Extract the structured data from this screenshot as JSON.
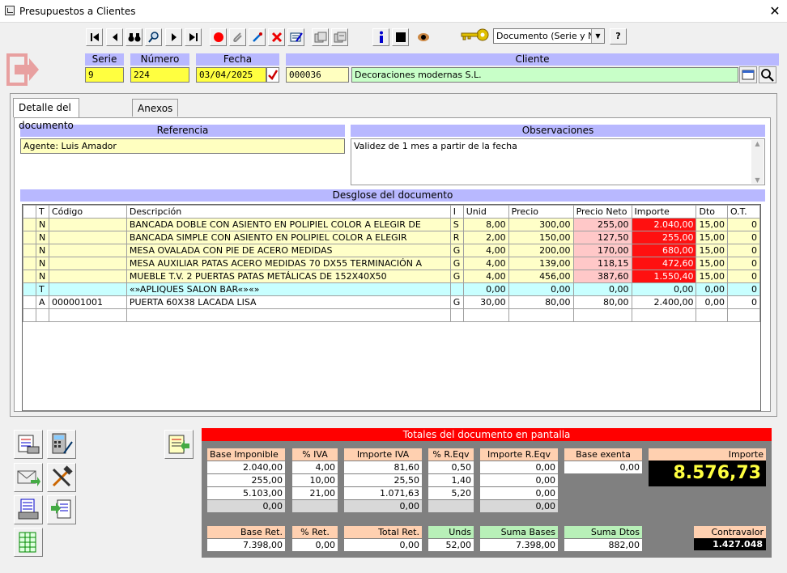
{
  "window": {
    "title": "Presupuestos a Clientes",
    "close": "✕"
  },
  "toolbar": {
    "doc_select": "Documento (Serie y Num",
    "help": "?"
  },
  "header": {
    "serie_label": "Serie",
    "serie": "9",
    "numero_label": "Número",
    "numero": "224",
    "fecha_label": "Fecha",
    "fecha": "03/04/2025",
    "cliente_label": "Cliente",
    "cliente_code": "000036",
    "cliente_name": "Decoraciones modernas S.L."
  },
  "tabs": {
    "detail": "Detalle del documento",
    "annex": "Anexos"
  },
  "referencia": {
    "label": "Referencia",
    "value": "Agente: Luis Amador"
  },
  "observaciones": {
    "label": "Observaciones",
    "value": "Validez de 1 mes a partir de la fecha"
  },
  "desglose": {
    "label": "Desglose del documento",
    "columns": [
      "",
      "T",
      "Código",
      "Descripción",
      "I",
      "Unid",
      "Precio",
      "Precio Neto",
      "Importe",
      "Dto",
      "O.T."
    ],
    "rows": [
      {
        "t": "N",
        "codigo": "",
        "desc": "BANCADA  DOBLE CON ASIENTO EN POLIPIEL COLOR A ELEGIR DE",
        "i": "S",
        "unid": "8,00",
        "precio": "300,00",
        "neto": "255,00",
        "importe": "2.040,00",
        "dto": "15,00",
        "ot": "0"
      },
      {
        "t": "N",
        "codigo": "",
        "desc": "BANCADA  SIMPLE  CON ASIENTO EN POLIPIEL COLOR A ELEGIR",
        "i": "R",
        "unid": "2,00",
        "precio": "150,00",
        "neto": "127,50",
        "importe": "255,00",
        "dto": "15,00",
        "ot": "0"
      },
      {
        "t": "N",
        "codigo": "",
        "desc": "MESA OVALADA CON PIE DE ACERO MEDIDAS",
        "i": "G",
        "unid": "4,00",
        "precio": "200,00",
        "neto": "170,00",
        "importe": "680,00",
        "dto": "15,00",
        "ot": "0"
      },
      {
        "t": "N",
        "codigo": "",
        "desc": "MESA AUXILIAR PATAS ACERO MEDIDAS 70 DX55  TERMINACIÓN A",
        "i": "G",
        "unid": "4,00",
        "precio": "139,00",
        "neto": "118,15",
        "importe": "472,60",
        "dto": "15,00",
        "ot": "0"
      },
      {
        "t": "N",
        "codigo": "",
        "desc": "MUEBLE T.V. 2 PUERTAS PATAS METÁLICAS DE 152X40X50",
        "i": "G",
        "unid": "4,00",
        "precio": "456,00",
        "neto": "387,60",
        "importe": "1.550,40",
        "dto": "15,00",
        "ot": "0"
      },
      {
        "t": "T",
        "codigo": "",
        "desc": "«»APLIQUES SALON BAR«»«»",
        "i": "",
        "unid": "0,00",
        "precio": "0,00",
        "neto": "0,00",
        "importe": "0,00",
        "dto": "0,00",
        "ot": "0"
      },
      {
        "t": "A",
        "codigo": "000001001",
        "desc": "PUERTA 60X38 LACADA LISA",
        "i": "G",
        "unid": "30,00",
        "precio": "80,00",
        "neto": "80,00",
        "importe": "2.400,00",
        "dto": "0,00",
        "ot": "0"
      }
    ]
  },
  "totals": {
    "title": "Totales del documento en pantalla",
    "h_base": "Base Imponible",
    "h_iva": "% IVA",
    "h_imp_iva": "Importe IVA",
    "h_req": "% R.Eqv",
    "h_imp_req": "Importe R.Eqv",
    "h_exenta": "Base exenta",
    "h_importe": "Importe",
    "rows": [
      {
        "base": "2.040,00",
        "iva": "4,00",
        "imp_iva": "81,60",
        "req": "0,50",
        "imp_req": "0,00"
      },
      {
        "base": "255,00",
        "iva": "10,00",
        "imp_iva": "25,50",
        "req": "1,40",
        "imp_req": "0,00"
      },
      {
        "base": "5.103,00",
        "iva": "21,00",
        "imp_iva": "1.071,63",
        "req": "5,20",
        "imp_req": "0,00"
      },
      {
        "base": "0,00",
        "iva": "",
        "imp_iva": "0,00",
        "req": "",
        "imp_req": "0,00"
      }
    ],
    "exenta": "0,00",
    "importe": "8.576,73",
    "h_base_ret": "Base Ret.",
    "h_ret": "% Ret.",
    "h_total_ret": "Total Ret.",
    "h_unds": "Unds",
    "h_suma_bases": "Suma Bases",
    "h_suma_dtos": "Suma Dtos",
    "h_contravalor": "Contravalor",
    "base_ret": "7.398,00",
    "ret": "0,00",
    "total_ret": "0,00",
    "unds": "52,00",
    "suma_bases": "7.398,00",
    "suma_dtos": "882,00",
    "contravalor": "1.427.048"
  }
}
